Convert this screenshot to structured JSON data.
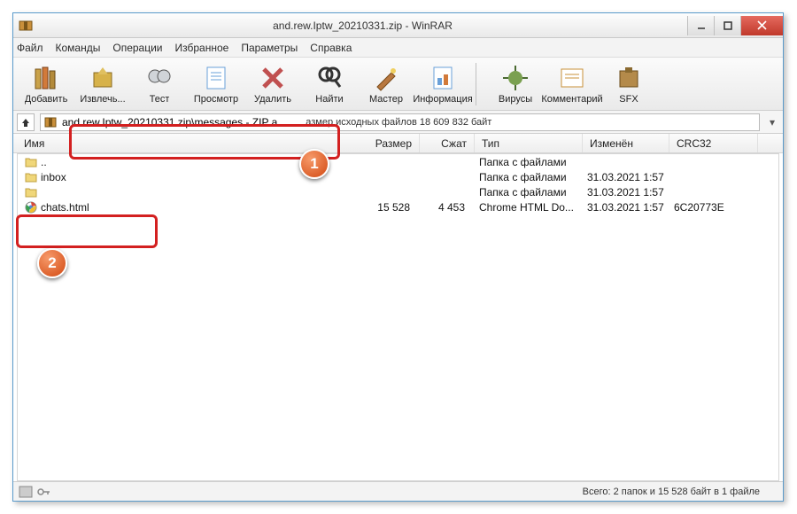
{
  "window": {
    "title": "and.rew.Iptw_20210331.zip - WinRAR"
  },
  "menu": [
    "Файл",
    "Команды",
    "Операции",
    "Избранное",
    "Параметры",
    "Справка"
  ],
  "toolbar": [
    {
      "label": "Добавить",
      "color": "#c9a24a"
    },
    {
      "label": "Извлечь...",
      "color": "#d7b24a"
    },
    {
      "label": "Тест",
      "color": "#808890"
    },
    {
      "label": "Просмотр",
      "color": "#6aa0d8"
    },
    {
      "label": "Удалить",
      "color": "#c05050"
    },
    {
      "label": "Найти",
      "color": "#555"
    },
    {
      "label": "Мастер",
      "color": "#b87840"
    },
    {
      "label": "Информация",
      "color": "#6aa0d8"
    },
    {
      "label": "Вирусы",
      "color": "#7aa050"
    },
    {
      "label": "Комментарий",
      "color": "#c89038"
    },
    {
      "label": "SFX",
      "color": "#b48a4a"
    }
  ],
  "address": {
    "path": "and.rew.Iptw_20210331.zip\\messages - ZIP а",
    "sizeinfo": "азмер исходных файлов 18 609 832 байт"
  },
  "columns": {
    "name": "Имя",
    "size": "Размер",
    "packed": "Сжат",
    "type": "Тип",
    "mod": "Изменён",
    "crc": "CRC32"
  },
  "rows": [
    {
      "icon": "folder",
      "name": "..",
      "type": "Папка с файлами",
      "size": "",
      "packed": "",
      "mod": "",
      "crc": ""
    },
    {
      "icon": "folder",
      "name": "inbox",
      "type": "Папка с файлами",
      "size": "",
      "packed": "",
      "mod": "31.03.2021 1:57",
      "crc": ""
    },
    {
      "icon": "folder",
      "name": "",
      "type": "Папка с файлами",
      "size": "",
      "packed": "",
      "mod": "31.03.2021 1:57",
      "crc": ""
    },
    {
      "icon": "chrome",
      "name": "chats.html",
      "type": "Chrome HTML Do...",
      "size": "15 528",
      "packed": "4 453",
      "mod": "31.03.2021 1:57",
      "crc": "6C20773E"
    }
  ],
  "status": {
    "summary": "Всего: 2 папок и 15 528 байт в 1 файле"
  },
  "markers": {
    "1": "1",
    "2": "2"
  }
}
